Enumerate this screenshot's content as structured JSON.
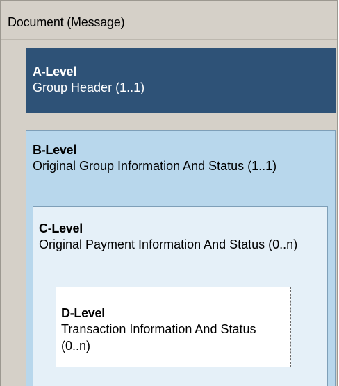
{
  "document": {
    "title": "Document (Message)"
  },
  "levels": {
    "a": {
      "title": "A-Level",
      "description": "Group Header (1..1)"
    },
    "b": {
      "title": "B-Level",
      "description": "Original Group Information And Status (1..1)"
    },
    "c": {
      "title": "C-Level",
      "description": "Original Payment Information And Status (0..n)"
    },
    "d": {
      "title": "D-Level",
      "description": "Transaction Information And Status (0..n)"
    }
  },
  "colors": {
    "document_bg": "#d5d0c8",
    "a_level_bg": "#2e5277",
    "b_level_bg": "#b8d7ec",
    "c_level_bg": "#e5f0f8",
    "d_level_bg": "#ffffff"
  }
}
